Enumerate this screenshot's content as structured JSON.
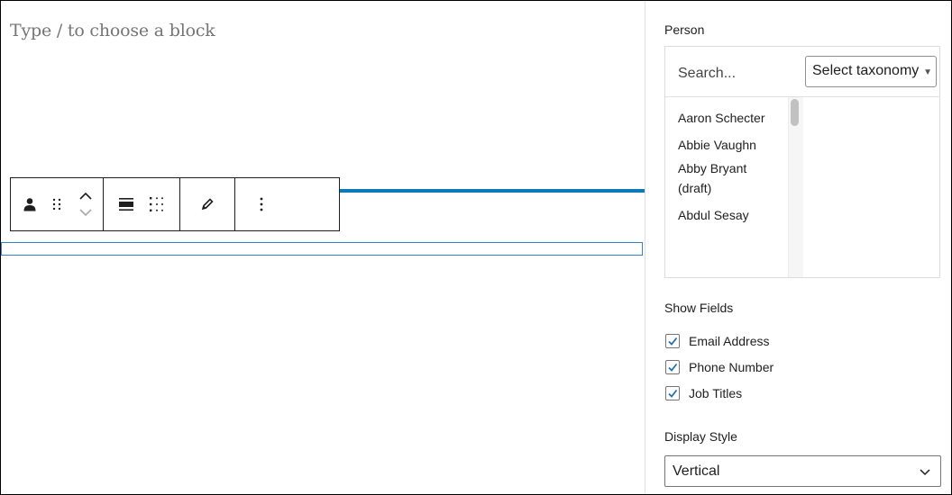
{
  "editor": {
    "placeholder": "Type / to choose a block",
    "toolbar": {
      "icons": [
        "person-icon",
        "drag-handle-icon",
        "move-up-down-icon",
        "align-icon",
        "grid-icon",
        "pencil-icon",
        "more-options-icon"
      ]
    }
  },
  "sidebar": {
    "person_label": "Person",
    "search_placeholder": "Search...",
    "taxonomy_select": "Select taxonomy",
    "people": [
      "Aaron Schecter",
      "Abbie Vaughn",
      "Abby Bryant (draft)",
      "Abdul Sesay"
    ],
    "show_fields_label": "Show Fields",
    "fields": [
      {
        "label": "Email Address",
        "checked": true
      },
      {
        "label": "Phone Number",
        "checked": true
      },
      {
        "label": "Job Titles",
        "checked": true
      }
    ],
    "display_style_label": "Display Style",
    "display_style_value": "Vertical"
  },
  "colors": {
    "accent": "#0a7ab8",
    "checkbox": "#2271b1"
  }
}
